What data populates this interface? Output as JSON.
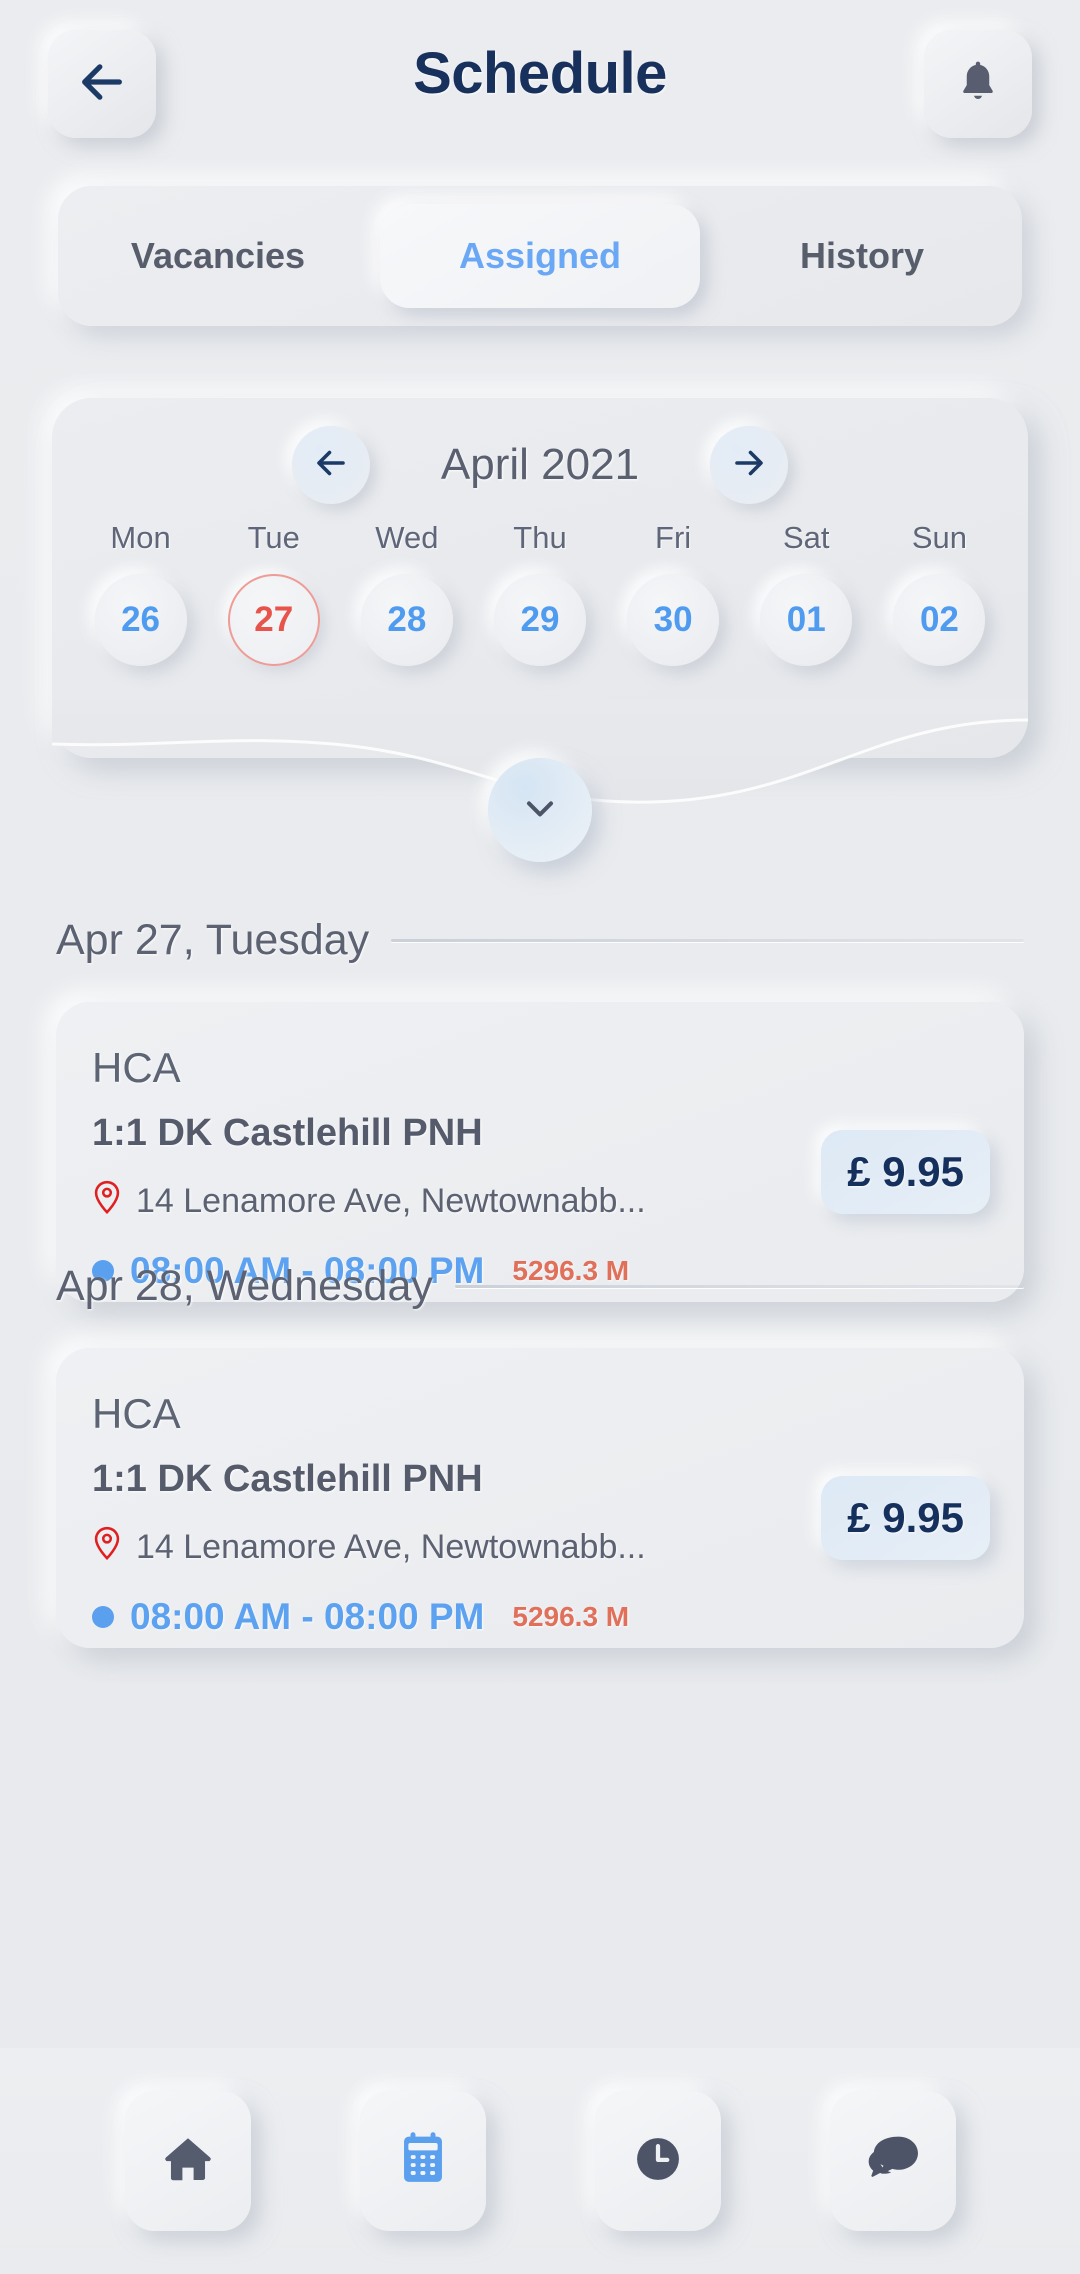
{
  "header": {
    "title": "Schedule",
    "back_icon": "arrow-left-icon",
    "bell_icon": "bell-icon"
  },
  "tabs": [
    {
      "label": "Vacancies",
      "active": false
    },
    {
      "label": "Assigned",
      "active": true
    },
    {
      "label": "History",
      "active": false
    }
  ],
  "calendar": {
    "month_label": "April 2021",
    "prev_icon": "arrow-left-icon",
    "next_icon": "arrow-right-icon",
    "expand_icon": "chevron-down-icon",
    "days": [
      {
        "dow": "Mon",
        "num": "26",
        "today": false
      },
      {
        "dow": "Tue",
        "num": "27",
        "today": true
      },
      {
        "dow": "Wed",
        "num": "28",
        "today": false
      },
      {
        "dow": "Thu",
        "num": "29",
        "today": false
      },
      {
        "dow": "Fri",
        "num": "30",
        "today": false
      },
      {
        "dow": "Sat",
        "num": "01",
        "today": false
      },
      {
        "dow": "Sun",
        "num": "02",
        "today": false
      }
    ]
  },
  "sections": [
    {
      "header": "Apr 27, Tuesday",
      "job": {
        "role": "HCA",
        "name": "1:1 DK Castlehill PNH",
        "address": "14 Lenamore Ave, Newtownabb...",
        "time": "08:00 AM - 08:00 PM",
        "distance": "5296.3 M",
        "price": "£ 9.95",
        "pin_icon": "map-pin-icon",
        "status_dot": "status-dot"
      }
    },
    {
      "header": "Apr 28, Wednesday",
      "job": {
        "role": "HCA",
        "name": "1:1 DK Castlehill PNH",
        "address": "14 Lenamore Ave, Newtownabb...",
        "time": "08:00 AM - 08:00 PM",
        "distance": "5296.3 M",
        "price": "£ 9.95",
        "pin_icon": "map-pin-icon",
        "status_dot": "status-dot"
      }
    }
  ],
  "bottom_nav": [
    {
      "icon": "home-icon",
      "active": false
    },
    {
      "icon": "calendar-icon",
      "active": true
    },
    {
      "icon": "clock-icon",
      "active": false
    },
    {
      "icon": "chat-icon",
      "active": false
    }
  ],
  "colors": {
    "background": "#e9ebee",
    "title": "#17305c",
    "accent_blue": "#5ca2f0",
    "today_red": "#e8544a",
    "distance_orange": "#e0705a",
    "pin_red": "#e02020",
    "text_slate": "#5c6272",
    "price_navy": "#15305c"
  }
}
